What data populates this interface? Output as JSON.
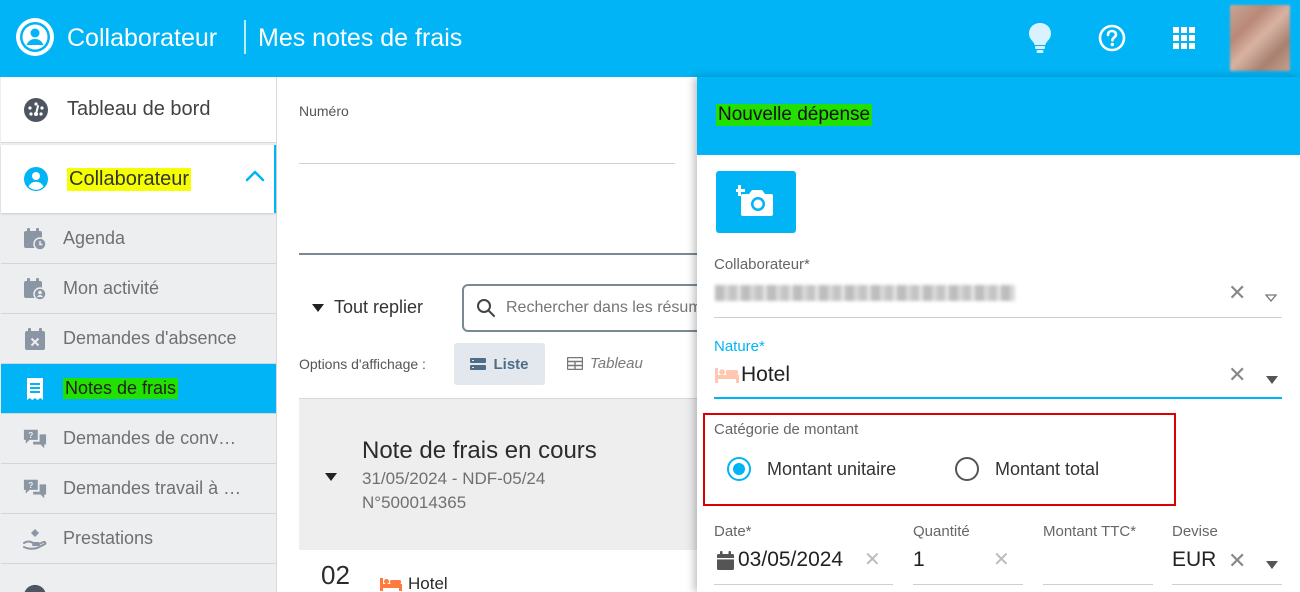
{
  "header": {
    "app_title": "Collaborateur",
    "page_title": "Mes notes de frais",
    "accent": "#00b4f5"
  },
  "sidebar": {
    "dashboard": "Tableau de bord",
    "collaborateur": "Collaborateur",
    "items": [
      {
        "label": "Agenda",
        "icon": "calendar-clock-icon"
      },
      {
        "label": "Mon activité",
        "icon": "calendar-user-icon"
      },
      {
        "label": "Demandes d'absence",
        "icon": "calendar-x-icon"
      },
      {
        "label": "Notes de frais",
        "icon": "receipt-icon",
        "active": true
      },
      {
        "label": "Demandes de conv…",
        "icon": "chat-bubbles-icon"
      },
      {
        "label": "Demandes travail à …",
        "icon": "chat-bubbles-icon"
      },
      {
        "label": "Prestations",
        "icon": "hand-icon"
      }
    ]
  },
  "main": {
    "numero_label": "Numéro",
    "toggle_label": "Tout replier",
    "search_placeholder": "Rechercher dans les résumés",
    "display_options_label": "Options d'affichage :",
    "view_list": "Liste",
    "view_table": "Tableau",
    "card": {
      "title": "Note de frais en cours",
      "line1": "31/05/2024 - NDF-05/24",
      "line2": "N°500014365"
    },
    "expense_row": {
      "day": "02",
      "nature": "Hotel"
    }
  },
  "panel": {
    "title": "Nouvelle dépense",
    "collaborateur_label": "Collaborateur*",
    "nature_label": "Nature*",
    "nature_value": "Hotel",
    "category_label": "Catégorie de montant",
    "radio_unit": "Montant unitaire",
    "radio_total": "Montant total",
    "radio_selected": "Montant unitaire",
    "date_label": "Date*",
    "date_value": "03/05/2024",
    "quantity_label": "Quantité",
    "quantity_value": "1",
    "amount_label": "Montant TTC*",
    "currency_label": "Devise",
    "currency_value": "EUR"
  }
}
